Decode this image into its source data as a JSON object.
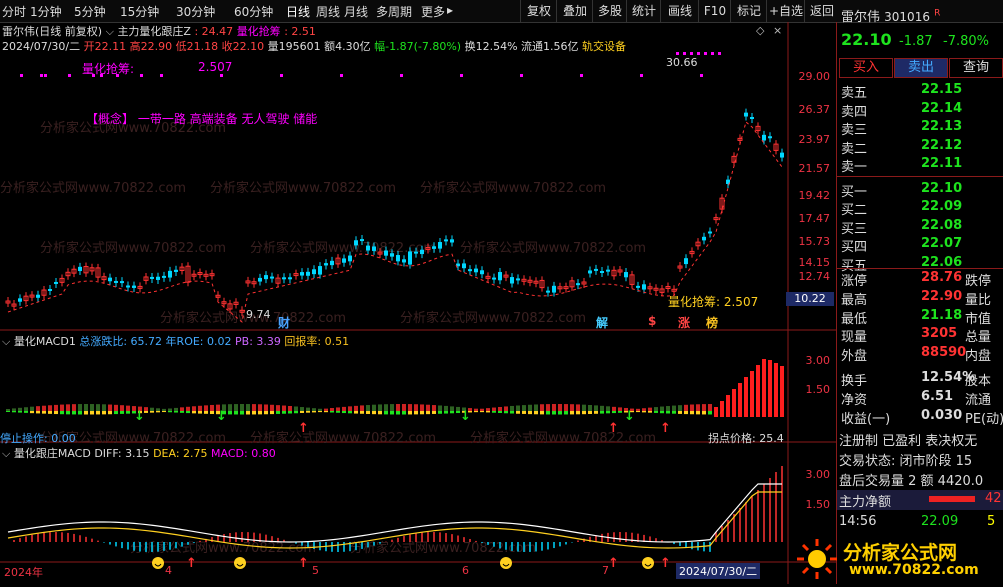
{
  "toolbar": {
    "periods": [
      "分时",
      "1分钟",
      "5分钟",
      "15分钟",
      "30分钟",
      "60分钟",
      "日线",
      "周线",
      "月线",
      "多周期",
      "更多"
    ],
    "more_arrow": "▸",
    "buttons": [
      "复权",
      "叠加",
      "多股",
      "统计",
      "画线",
      "F10",
      "标记",
      "+自选",
      "返回"
    ]
  },
  "stock": {
    "name": "雷尔伟",
    "code": "301016",
    "flag": "R",
    "price": "22.10",
    "change": "-1.87",
    "pct": "-7.80%"
  },
  "header": {
    "title": "雷尔伟(日线 前复权)",
    "indicator": "主力量化跟庄Z",
    "ind_val": ": 24.47",
    "ind_name2": "量化抢筹",
    "ind_val2": ": 2.51",
    "date_line": "2024/07/30/二",
    "open": "开22.11",
    "high": "高22.90",
    "low": "低21.18",
    "close": "收22.10",
    "vol": "量195601",
    "amt": "额4.30亿",
    "amp": "幅-1.87(-7.80%)",
    "turnover": "换12.54%",
    "float": "流通1.56亿",
    "concept": "轨交设备",
    "qhcz_label": "量化抢筹:",
    "qhcz_val": "2.507",
    "concept_text": "【概念】 一带一路 高端装备 无人驾驶 储能",
    "peak": "30.66",
    "low_mark": "9.74",
    "qhcz_bottom": "量化抢筹: 2.507"
  },
  "price_axis": [
    "29.00",
    "26.37",
    "23.97",
    "21.57",
    "19.42",
    "17.47",
    "15.73",
    "14.15",
    "12.74"
  ],
  "current_price_tag": "10.22",
  "event_tags": [
    {
      "t": "财",
      "c": "#4aa3ff"
    },
    {
      "t": "解",
      "c": "#4cf"
    },
    {
      "t": "$",
      "c": "#f44"
    },
    {
      "t": "涨",
      "c": "#f44"
    },
    {
      "t": "榜",
      "c": "#f7c020"
    }
  ],
  "macd1": {
    "name": "量化MACD1",
    "label1": "总涨跌比:",
    "val1": "65.72",
    "label2": "年ROE:",
    "val2": "0.02",
    "label3": "PB:",
    "val3": "3.39",
    "label4": "回报率:",
    "val4": "0.51",
    "stop_label": "停止操作:",
    "stop_val": "0.00",
    "turn_label": "拐点价格:",
    "turn_val": "25.4",
    "axis": [
      "3.00",
      "1.50"
    ]
  },
  "macd2": {
    "name": "量化跟庄MACD",
    "diff_label": "DIFF:",
    "diff": "3.15",
    "dea_label": "DEA:",
    "dea": "2.75",
    "macd_label": "MACD:",
    "macd": "0.80",
    "axis": [
      "3.00",
      "1.50"
    ]
  },
  "xaxis": {
    "labels": [
      "2024年",
      "4",
      "5",
      "6",
      "7"
    ],
    "cursor": "2024/07/30/二"
  },
  "watermark": "分析家公式网www.70822.com",
  "orderbook": {
    "sells": [
      {
        "l": "卖五",
        "p": "22.15"
      },
      {
        "l": "卖四",
        "p": "22.14"
      },
      {
        "l": "卖三",
        "p": "22.13"
      },
      {
        "l": "卖二",
        "p": "22.12"
      },
      {
        "l": "卖一",
        "p": "22.11"
      }
    ],
    "buys": [
      {
        "l": "买一",
        "p": "22.10"
      },
      {
        "l": "买二",
        "p": "22.09"
      },
      {
        "l": "买三",
        "p": "22.08"
      },
      {
        "l": "买四",
        "p": "22.07"
      },
      {
        "l": "买五",
        "p": "22.06"
      }
    ],
    "actions": [
      "买入",
      "卖出",
      "查询"
    ]
  },
  "stats": [
    {
      "a": "涨停",
      "b": "28.76",
      "c": "跌停"
    },
    {
      "a": "最高",
      "b": "22.90",
      "c": "量比"
    },
    {
      "a": "最低",
      "b": "21.18",
      "c": "市值"
    },
    {
      "a": "现量",
      "b": "3205",
      "c": "总量"
    },
    {
      "a": "外盘",
      "b": "88590",
      "c": "内盘"
    },
    {
      "a": "换手",
      "b": "12.54%",
      "c": "股本"
    },
    {
      "a": "净资",
      "b": "6.51",
      "c": "流通"
    },
    {
      "a": "收益(一)",
      "b": "0.030",
      "c": "PE(动)"
    }
  ],
  "info": {
    "reg": "注册制 已盈利 表决权无",
    "state": "交易状态: 闭市阶段 15",
    "after": "盘后交易量 2 额 4420.0",
    "net_label": "主力净额",
    "net_val": "42",
    "time": "14:56",
    "tprice": "22.09",
    "tvol": "5"
  },
  "logo": {
    "text": "分析家公式网",
    "url": "www.70822.com"
  },
  "colors": {
    "up": "#ff3232",
    "down": "#00d7ff",
    "green": "#1ee31e",
    "magenta": "#ff00ff",
    "yellow": "#ffd020",
    "dark_red": "#8b1a1a"
  }
}
